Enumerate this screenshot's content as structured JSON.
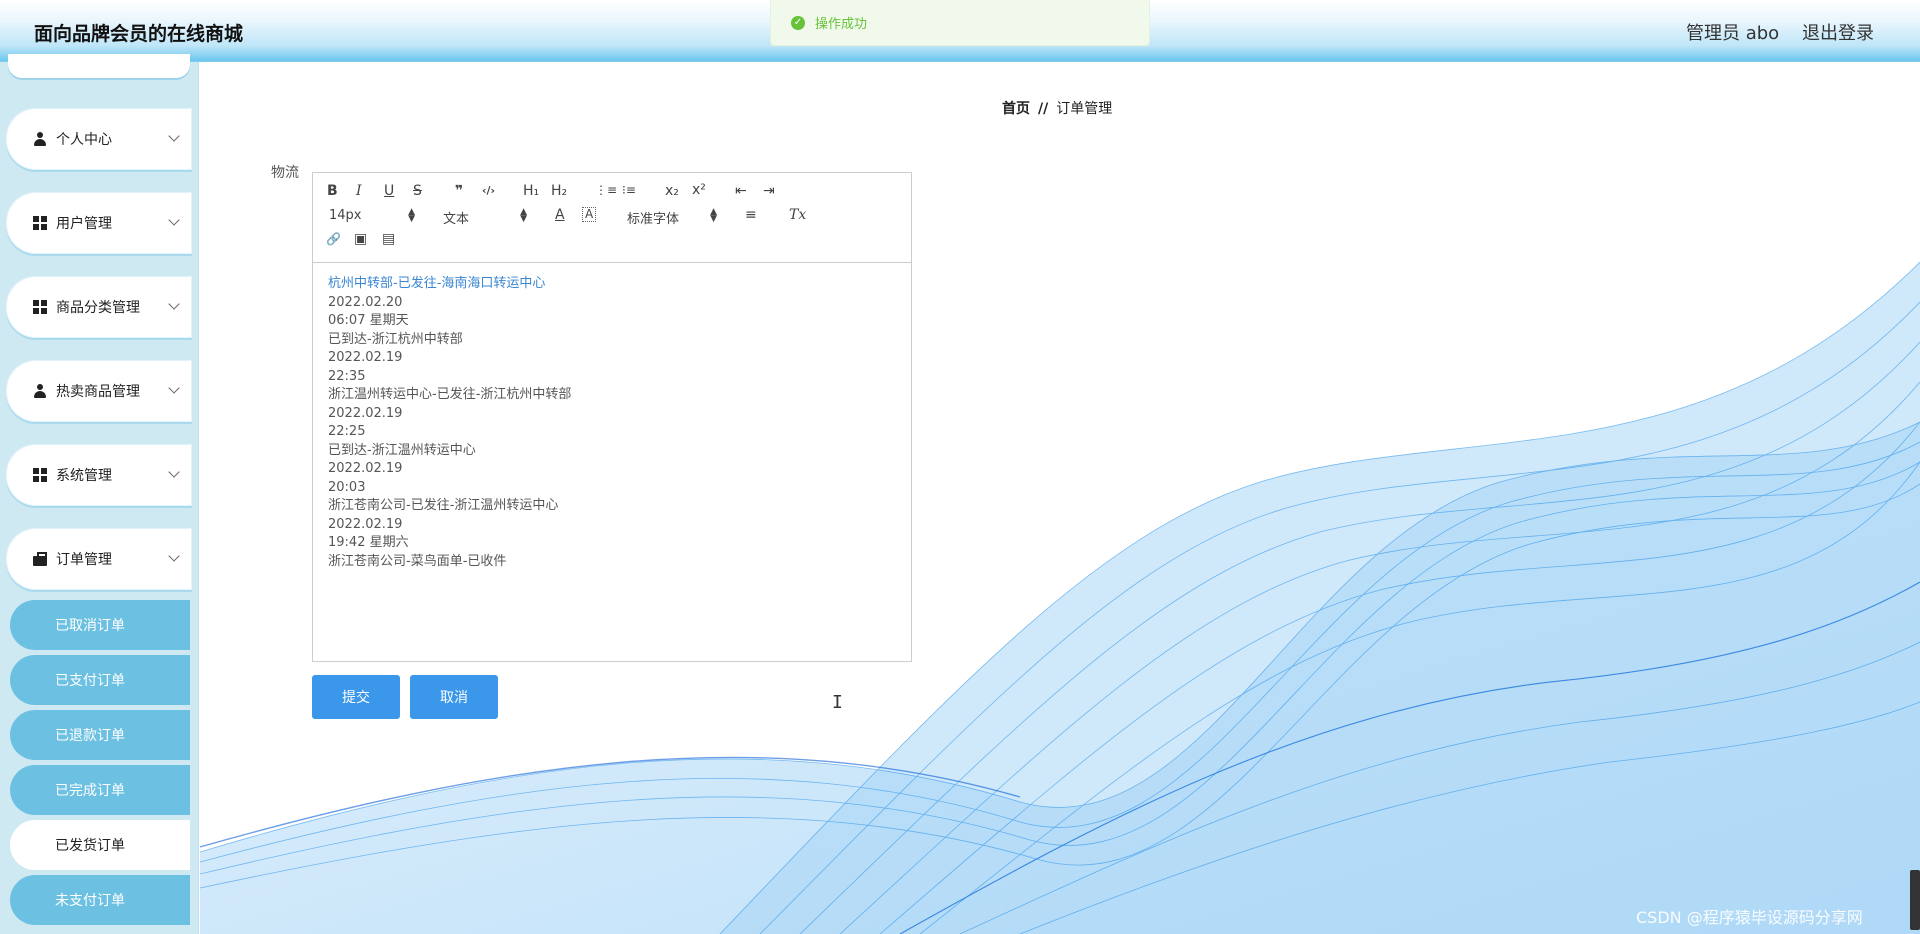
{
  "app": {
    "title": "面向品牌会员的在线商城",
    "user_label": "管理员 abo",
    "logout_label": "退出登录"
  },
  "toast": {
    "text": "操作成功",
    "icon": "check-circle-icon",
    "color": "#67c23a"
  },
  "sidebar": {
    "menus": [
      {
        "label": "个人中心",
        "icon": "user-icon"
      },
      {
        "label": "用户管理",
        "icon": "grid-icon"
      },
      {
        "label": "商品分类管理",
        "icon": "grid-icon"
      },
      {
        "label": "热卖商品管理",
        "icon": "user-icon"
      },
      {
        "label": "系统管理",
        "icon": "grid-icon"
      },
      {
        "label": "订单管理",
        "icon": "briefcase-icon"
      }
    ],
    "submenu": [
      {
        "label": "已取消订单",
        "active": false
      },
      {
        "label": "已支付订单",
        "active": false
      },
      {
        "label": "已退款订单",
        "active": false
      },
      {
        "label": "已完成订单",
        "active": false
      },
      {
        "label": "已发货订单",
        "active": true
      },
      {
        "label": "未支付订单",
        "active": false
      }
    ]
  },
  "breadcrumb": {
    "home": "首页",
    "separator": "//",
    "current": "订单管理"
  },
  "form": {
    "field_label": "物流",
    "toolbar": {
      "bold": "B",
      "italic": "I",
      "underline": "U",
      "strike": "S",
      "quote": "❞",
      "code": "‹/›",
      "h1": "H₁",
      "h2": "H₂",
      "ordered_list": "⋮≡",
      "bullet_list": "⁝≡",
      "sub": "x₂",
      "sup": "x²",
      "outdent": "⇤",
      "indent": "⇥",
      "size": "14px",
      "format": "文本",
      "color": "A",
      "background": "A",
      "font": "标准字体",
      "align": "≡",
      "clear": "Tx",
      "link": "🔗",
      "image": "▣",
      "video": "▤"
    },
    "content_lines": [
      "杭州中转部-已发往-海南海口转运中心",
      "2022.02.20",
      "06:07 星期天",
      "已到达-浙江杭州中转部",
      "2022.02.19",
      "22:35",
      "浙江温州转运中心-已发往-浙江杭州中转部",
      "2022.02.19",
      "22:25",
      "已到达-浙江温州转运中心",
      "2022.02.19",
      "20:03",
      "浙江苍南公司-已发往-浙江温州转运中心",
      "2022.02.19",
      "19:42 星期六",
      "浙江苍南公司-菜鸟面单-已收件"
    ],
    "submit_label": "提交",
    "cancel_label": "取消"
  },
  "watermark": "CSDN @程序猿毕设源码分享网",
  "colors": {
    "accent": "#3a97ea",
    "submenu_bg": "#6cc1e2",
    "header_bottom": "#6cc6ee",
    "wave": "#1e8ce8"
  }
}
